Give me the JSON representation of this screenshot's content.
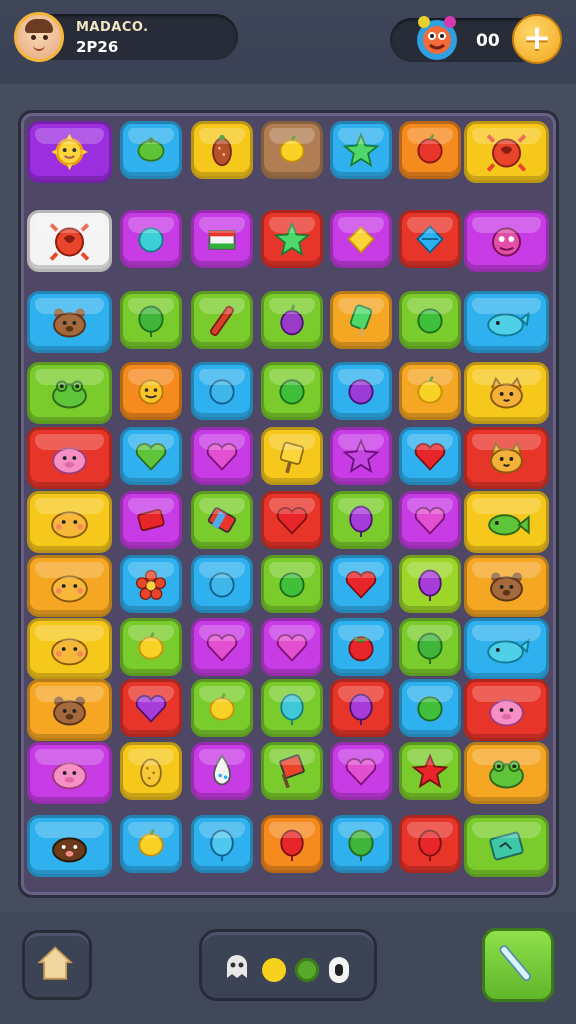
{
  "player": {
    "name": "MADACO.",
    "score": "2P26"
  },
  "currency": {
    "value": "00",
    "add_label": "+"
  },
  "colors": {
    "purple": "#9b2fe0",
    "blue": "#2fb1ef",
    "yellow": "#f7c81c",
    "brown": "#b07e52",
    "orange": "#f58a1e",
    "white": "#f4f4f4",
    "magenta": "#c83ce6",
    "red": "#e8352a",
    "green": "#7acc2c",
    "pink": "#f054c4",
    "amber": "#f5a623",
    "lime": "#9bd628"
  },
  "board": {
    "rows": [
      [
        {
          "color": "purple",
          "icon": "sun-icon"
        },
        {
          "color": "blue",
          "icon": "lime-fruit-icon"
        },
        {
          "color": "yellow",
          "icon": "bean-icon"
        },
        {
          "color": "brown",
          "icon": "lemon-icon"
        },
        {
          "color": "blue",
          "icon": "star-icon"
        },
        {
          "color": "orange",
          "icon": "red-berry-icon"
        },
        {
          "color": "yellow",
          "icon": "crab-emblem-icon"
        }
      ],
      [
        {
          "color": "white",
          "icon": "crab-emblem-icon"
        },
        {
          "color": "magenta",
          "icon": "teal-gem-icon"
        },
        {
          "color": "magenta",
          "icon": "striped-block-icon"
        },
        {
          "color": "red",
          "icon": "star-icon"
        },
        {
          "color": "magenta",
          "icon": "yellow-diamond-icon"
        },
        {
          "color": "red",
          "icon": "blue-diamond-icon"
        },
        {
          "color": "magenta",
          "icon": "dragon-emblem-icon"
        }
      ],
      [
        {
          "color": "blue",
          "icon": "bear-face-icon"
        },
        {
          "color": "green",
          "icon": "green-balloon-icon"
        },
        {
          "color": "green",
          "icon": "stick-icon"
        },
        {
          "color": "green",
          "icon": "plum-icon"
        },
        {
          "color": "amber",
          "icon": "green-popsicle-icon"
        },
        {
          "color": "green",
          "icon": "green-orb-icon"
        },
        {
          "color": "blue",
          "icon": "whale-icon"
        }
      ],
      [
        {
          "color": "green",
          "icon": "frog-face-icon"
        },
        {
          "color": "orange",
          "icon": "smiley-icon"
        },
        {
          "color": "blue",
          "icon": "blue-orb-icon"
        },
        {
          "color": "green",
          "icon": "green-orb-icon"
        },
        {
          "color": "blue",
          "icon": "purple-orb-icon"
        },
        {
          "color": "amber",
          "icon": "lemon-icon"
        },
        {
          "color": "yellow",
          "icon": "cat-face-icon"
        }
      ],
      [
        {
          "color": "red",
          "icon": "pig-face-icon"
        },
        {
          "color": "blue",
          "icon": "green-heart-icon"
        },
        {
          "color": "magenta",
          "icon": "pink-heart-icon"
        },
        {
          "color": "yellow",
          "icon": "yellow-sign-icon"
        },
        {
          "color": "magenta",
          "icon": "purple-star-icon"
        },
        {
          "color": "blue",
          "icon": "red-heart-icon"
        },
        {
          "color": "red",
          "icon": "cat-face-icon"
        }
      ],
      [
        {
          "color": "yellow",
          "icon": "hamster-face-icon"
        },
        {
          "color": "magenta",
          "icon": "red-block-icon"
        },
        {
          "color": "green",
          "icon": "candy-block-icon"
        },
        {
          "color": "red",
          "icon": "red-heart-icon"
        },
        {
          "color": "green",
          "icon": "purple-balloon-icon"
        },
        {
          "color": "magenta",
          "icon": "pink-heart-icon"
        },
        {
          "color": "yellow",
          "icon": "fish-icon"
        }
      ],
      [
        {
          "color": "amber",
          "icon": "hamster-face-icon"
        },
        {
          "color": "blue",
          "icon": "flower-icon"
        },
        {
          "color": "blue",
          "icon": "blue-orb-icon"
        },
        {
          "color": "green",
          "icon": "green-orb-icon"
        },
        {
          "color": "blue",
          "icon": "red-heart-icon"
        },
        {
          "color": "lime",
          "icon": "purple-balloon-icon"
        },
        {
          "color": "amber",
          "icon": "bear-face-icon"
        }
      ],
      [
        {
          "color": "yellow",
          "icon": "hamster-face-icon"
        },
        {
          "color": "green",
          "icon": "lemon-icon"
        },
        {
          "color": "magenta",
          "icon": "pink-heart-icon"
        },
        {
          "color": "magenta",
          "icon": "pink-heart-icon"
        },
        {
          "color": "blue",
          "icon": "tomato-icon"
        },
        {
          "color": "green",
          "icon": "green-balloon-icon"
        },
        {
          "color": "blue",
          "icon": "whale-icon"
        }
      ],
      [
        {
          "color": "amber",
          "icon": "bear-face-icon"
        },
        {
          "color": "red",
          "icon": "purple-heart-icon"
        },
        {
          "color": "green",
          "icon": "lemon-icon"
        },
        {
          "color": "green",
          "icon": "teal-balloon-icon"
        },
        {
          "color": "red",
          "icon": "purple-balloon-icon"
        },
        {
          "color": "blue",
          "icon": "green-orb-icon"
        },
        {
          "color": "red",
          "icon": "pig-face-icon"
        }
      ],
      [
        {
          "color": "magenta",
          "icon": "pig-face-icon"
        },
        {
          "color": "yellow",
          "icon": "speckled-egg-icon"
        },
        {
          "color": "magenta",
          "icon": "water-drop-icon"
        },
        {
          "color": "green",
          "icon": "sign-post-icon"
        },
        {
          "color": "magenta",
          "icon": "pink-heart-icon"
        },
        {
          "color": "green",
          "icon": "red-star-icon"
        },
        {
          "color": "amber",
          "icon": "frog-face-icon"
        }
      ],
      [
        {
          "color": "blue",
          "icon": "mole-face-icon"
        },
        {
          "color": "blue",
          "icon": "lemon-icon"
        },
        {
          "color": "blue",
          "icon": "blue-balloon-icon"
        },
        {
          "color": "orange",
          "icon": "red-balloon-icon"
        },
        {
          "color": "blue",
          "icon": "green-balloon-icon"
        },
        {
          "color": "red",
          "icon": "red-balloon-icon"
        },
        {
          "color": "green",
          "icon": "ticket-icon"
        }
      ]
    ]
  },
  "nav": {
    "home_icon": "home-icon",
    "boosters": [
      {
        "icon": "ghost-icon",
        "color": "#e8e8e8"
      },
      {
        "icon": "yellow-dot-icon",
        "color": "#f7d21c"
      },
      {
        "icon": "green-dot-icon",
        "color": "#57a92c"
      },
      {
        "icon": "eye-dot-icon",
        "color": "#f4f4f4"
      }
    ],
    "tool_icon": "wand-icon"
  }
}
